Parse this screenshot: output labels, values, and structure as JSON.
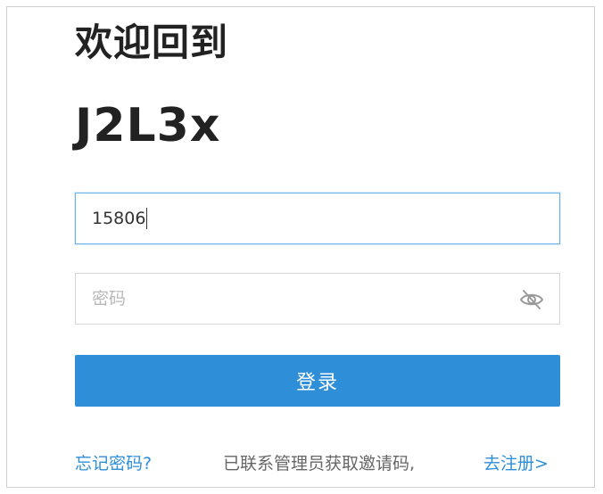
{
  "header": {
    "welcome": "欢迎回到",
    "brand": "J2L3x"
  },
  "form": {
    "phone_value": "15806",
    "password_placeholder": "密码",
    "password_toggle_icon": "eye-off-icon",
    "login_label": "登录"
  },
  "footer": {
    "forgot_label": "忘记密码?",
    "invite_text": "已联系管理员获取邀请码,",
    "register_label": "去注册>"
  },
  "colors": {
    "accent": "#2e8ed8",
    "focus_border": "#6fb2ea",
    "title_text": "#222222"
  }
}
